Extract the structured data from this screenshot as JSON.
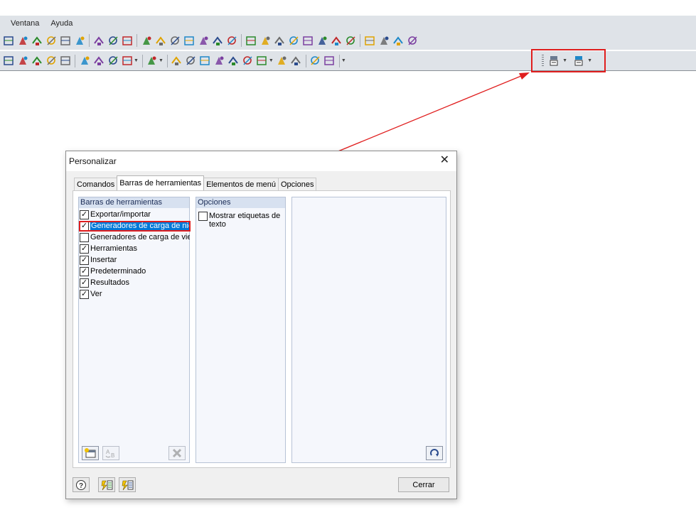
{
  "menubar": {
    "items": [
      "Ventana",
      "Ayuda"
    ]
  },
  "dialog": {
    "title": "Personalizar",
    "close_glyph": "✕",
    "tabs": [
      "Comandos",
      "Barras de herramientas",
      "Elementos de menú",
      "Opciones"
    ],
    "active_tab": "Barras de herramientas",
    "toolbars_header": "Barras de herramientas",
    "toolbars": [
      {
        "label": "Exportar/importar",
        "checked": true
      },
      {
        "label": "Generadores de carga de nie",
        "checked": true,
        "selected": true
      },
      {
        "label": "Generadores de carga de vie",
        "checked": false
      },
      {
        "label": "Herramientas",
        "checked": true
      },
      {
        "label": "Insertar",
        "checked": true
      },
      {
        "label": "Predeterminado",
        "checked": true
      },
      {
        "label": "Resultados",
        "checked": true
      },
      {
        "label": "Ver",
        "checked": true
      }
    ],
    "options_header": "Opciones",
    "show_labels_option": "Mostrar etiquetas de texto",
    "show_labels_checked": false,
    "close_button": "Cerrar"
  },
  "colors": {
    "highlight": "#e01e1e",
    "selection": "#0078d7",
    "pane_header": "#d7e1f0"
  },
  "icons": {
    "new_toolbar": "new-toolbar-icon",
    "rename_toolbar": "rename-toolbar-icon",
    "delete_toolbar": "delete-toolbar-icon",
    "reset": "reset-icon",
    "help": "help-icon",
    "import": "import-icon",
    "export": "export-icon"
  }
}
